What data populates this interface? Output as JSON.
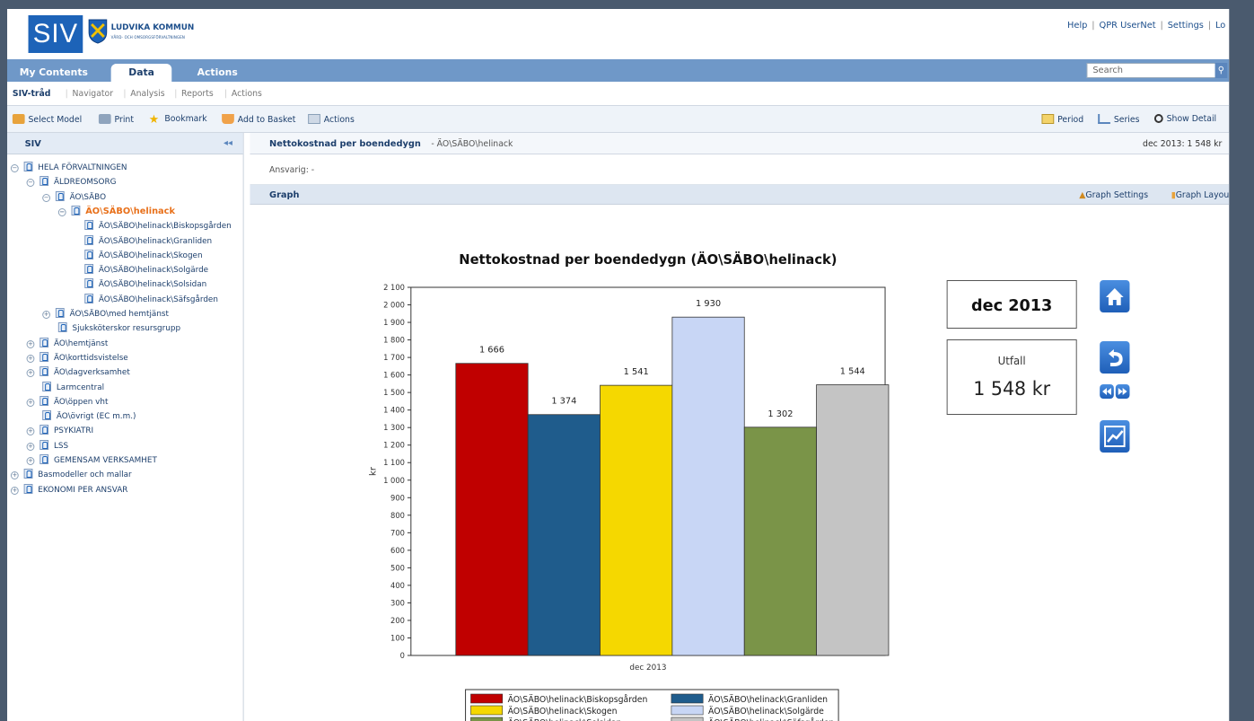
{
  "header": {
    "logo_text": "SIV",
    "org_name": "LUDVIKA KOMMUN",
    "org_sub": "VÅRD- OCH OMSORGSFÖRVALTNINGEN",
    "links": [
      "Help",
      "QPR UserNet",
      "Settings",
      "Lo"
    ]
  },
  "tabs": [
    "My Contents",
    "Data",
    "Actions"
  ],
  "search": {
    "placeholder": "Search"
  },
  "subnav": [
    "SIV-tråd",
    "Navigator",
    "Analysis",
    "Reports",
    "Actions"
  ],
  "toolbar": {
    "left": [
      "Select Model",
      "Print",
      "Bookmark",
      "Add to Basket",
      "Actions"
    ],
    "right": [
      "Period",
      "Series",
      "Show Detail"
    ]
  },
  "sidebar": {
    "title": "SIV",
    "tree": [
      {
        "label": "HELA FÖRVALTNINGEN",
        "level": 0,
        "toggle": "minus"
      },
      {
        "label": "ÄLDREOMSORG",
        "level": 1,
        "toggle": "minus"
      },
      {
        "label": "ÄO\\SÄBO",
        "level": 2,
        "toggle": "minus"
      },
      {
        "label": "ÄO\\SÄBO\\helinack",
        "level": 3,
        "toggle": "minus",
        "selected": true
      },
      {
        "label": "ÄO\\SÄBO\\helinack\\Biskopsgården",
        "level": 4
      },
      {
        "label": "ÄO\\SÄBO\\helinack\\Granliden",
        "level": 4
      },
      {
        "label": "ÄO\\SÄBO\\helinack\\Skogen",
        "level": 4
      },
      {
        "label": "ÄO\\SÄBO\\helinack\\Solgärde",
        "level": 4
      },
      {
        "label": "ÄO\\SÄBO\\helinack\\Solsidan",
        "level": 4
      },
      {
        "label": "ÄO\\SÄBO\\helinack\\Säfsgården",
        "level": 4
      },
      {
        "label": "ÄO\\SÄBO\\med hemtjänst",
        "level": 2,
        "toggle": "plus"
      },
      {
        "label": "Sjuksköterskor resursgrupp",
        "level": 3
      },
      {
        "label": "ÄO\\hemtjänst",
        "level": 1,
        "toggle": "plus"
      },
      {
        "label": "ÄO\\korttidsvistelse",
        "level": 1,
        "toggle": "plus"
      },
      {
        "label": "ÄO\\dagverksamhet",
        "level": 1,
        "toggle": "plus"
      },
      {
        "label": "Larmcentral",
        "level": 2
      },
      {
        "label": "ÄO\\öppen vht",
        "level": 1,
        "toggle": "plus"
      },
      {
        "label": "ÄO\\övrigt (EC m.m.)",
        "level": 2
      },
      {
        "label": "PSYKIATRI",
        "level": 0.5,
        "toggle": "plus"
      },
      {
        "label": "LSS",
        "level": 0.5,
        "toggle": "plus"
      },
      {
        "label": "GEMENSAM VERKSAMHET",
        "level": 0.5,
        "toggle": "plus"
      },
      {
        "label": "Basmodeller och mallar",
        "level": 0,
        "toggle": "plus"
      },
      {
        "label": "EKONOMI PER ANSVAR",
        "level": 0,
        "toggle": "plus"
      }
    ]
  },
  "main": {
    "title": "Nettokostnad per boendedygn",
    "path": "- ÄO\\SÄBO\\helinack",
    "period_value": "dec 2013: 1 548 kr",
    "responsible": "Ansvarig: -",
    "graph_label": "Graph",
    "graph_settings": "Graph Settings",
    "graph_layout": "Graph Layou"
  },
  "side_panel": {
    "period": "dec 2013",
    "outcome_label": "Utfall",
    "outcome_value": "1 548 kr"
  },
  "colors": {
    "accent": "#1d63b8",
    "tabbar": "#6f98c8"
  },
  "chart_data": {
    "type": "bar",
    "title": "Nettokostnad per boendedygn (ÄO\\SÄBO\\helinack)",
    "categories": [
      "dec 2013"
    ],
    "ylabel": "kr",
    "ylim": [
      0,
      2100
    ],
    "yticks": [
      0,
      100,
      200,
      300,
      400,
      500,
      600,
      700,
      800,
      900,
      1000,
      1100,
      1200,
      1300,
      1400,
      1500,
      1600,
      1700,
      1800,
      1900,
      2000,
      2100
    ],
    "ytick_labels": [
      "0",
      "100",
      "200",
      "300",
      "400",
      "500",
      "600",
      "700",
      "800",
      "900",
      "1 000",
      "1 100",
      "1 200",
      "1 300",
      "1 400",
      "1 500",
      "1 600",
      "1 700",
      "1 800",
      "1 900",
      "2 000",
      "2 100"
    ],
    "series": [
      {
        "name": "ÄO\\SÄBO\\helinack\\Biskopsgården",
        "value": 1666,
        "label": "1 666",
        "color": "#c00000"
      },
      {
        "name": "ÄO\\SÄBO\\helinack\\Granliden",
        "value": 1374,
        "label": "1 374",
        "color": "#1f5c8c"
      },
      {
        "name": "ÄO\\SÄBO\\helinack\\Skogen",
        "value": 1541,
        "label": "1 541",
        "color": "#f5d800"
      },
      {
        "name": "ÄO\\SÄBO\\helinack\\Solgärde",
        "value": 1930,
        "label": "1 930",
        "color": "#c8d6f5"
      },
      {
        "name": "ÄO\\SÄBO\\helinack\\Solsidan",
        "value": 1302,
        "label": "1 302",
        "color": "#7a9448"
      },
      {
        "name": "ÄO\\SÄBO\\helinack\\Säfsgården",
        "value": 1544,
        "label": "1 544",
        "color": "#c4c4c4"
      }
    ],
    "grid": false,
    "legend_position": "bottom"
  }
}
